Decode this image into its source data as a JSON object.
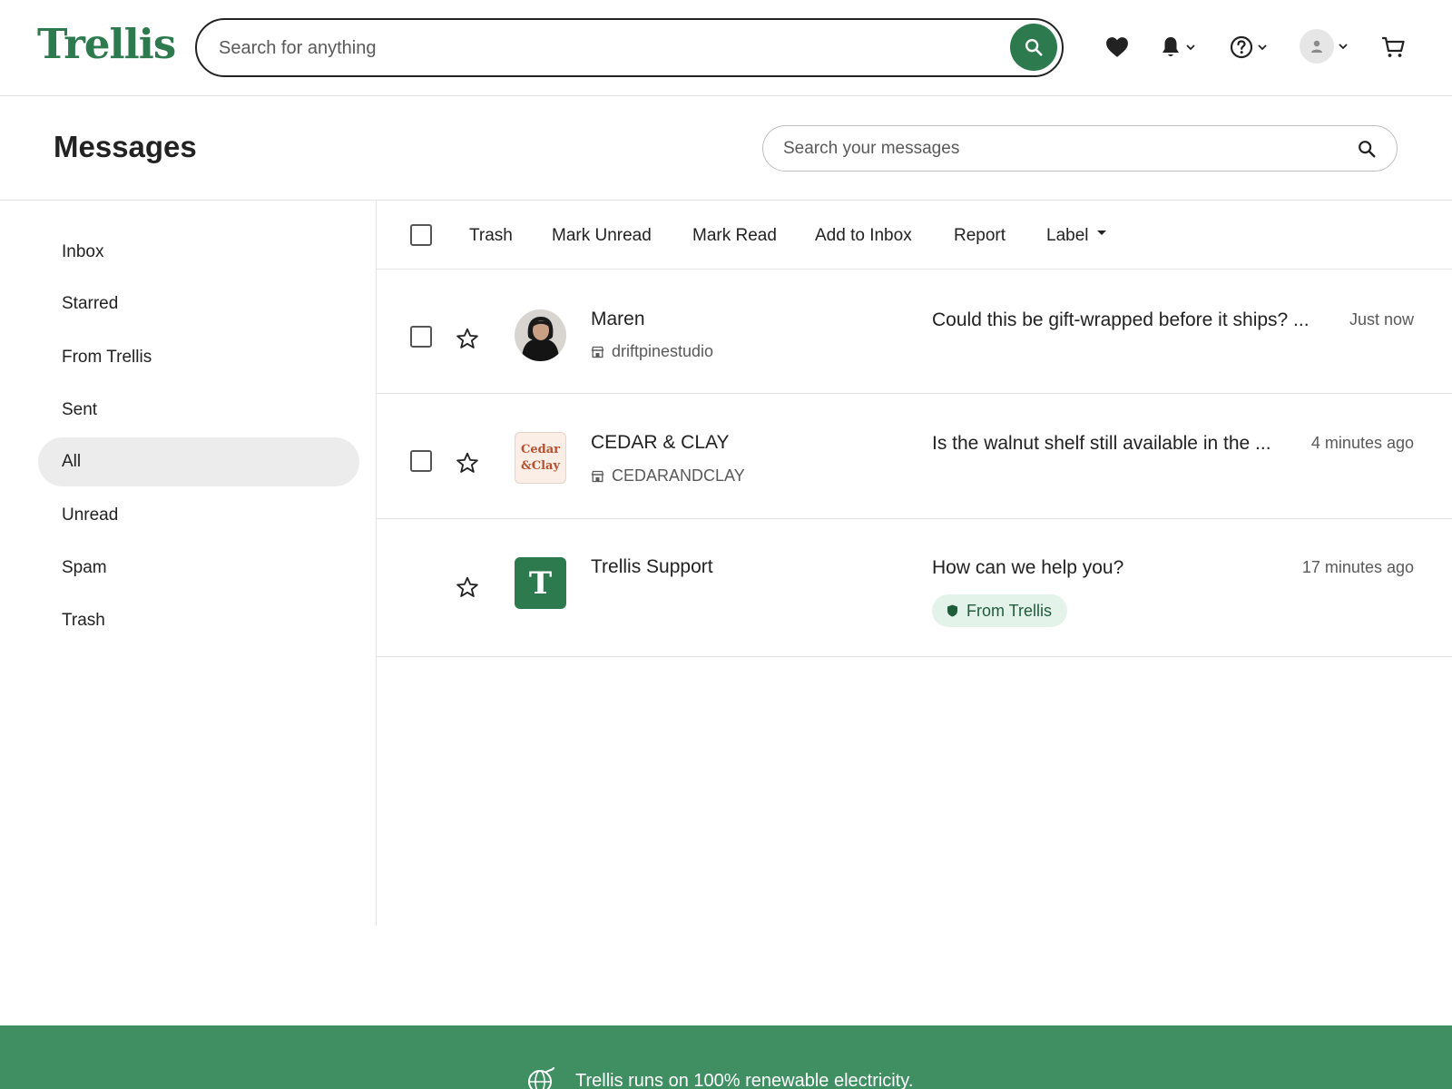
{
  "header": {
    "logo": "Trellis",
    "search_placeholder": "Search for anything",
    "icons": [
      "search-icon",
      "heart-icon",
      "bell-icon",
      "help-icon",
      "account-icon",
      "cart-icon"
    ]
  },
  "page": {
    "title": "Messages",
    "search_placeholder": "Search your messages"
  },
  "sidebar": {
    "items": [
      {
        "label": "Inbox",
        "active": false
      },
      {
        "label": "Starred",
        "active": false
      },
      {
        "label": "From Trellis",
        "active": false
      },
      {
        "label": "Sent",
        "active": false
      },
      {
        "label": "All",
        "active": true
      },
      {
        "label": "Unread",
        "active": false
      },
      {
        "label": "Spam",
        "active": false
      },
      {
        "label": "Trash",
        "active": false
      }
    ]
  },
  "toolbar": {
    "trash": "Trash",
    "mark_unread": "Mark Unread",
    "mark_read": "Mark Read",
    "add_to_inbox": "Add to Inbox",
    "report": "Report",
    "label": "Label"
  },
  "messages": [
    {
      "sender": "Maren",
      "shop": "driftpinestudio",
      "snippet": "Could this be gift-wrapped before it ships? ...",
      "time": "Just now"
    },
    {
      "sender": "CEDAR & CLAY",
      "shop": "CEDARANDCLAY",
      "avatar_text_1": "Cedar",
      "avatar_text_2": "&Clay",
      "snippet": "Is the walnut shelf still available in the ...",
      "time": "4 minutes ago"
    },
    {
      "sender": "Trellis Support",
      "avatar_letter": "T",
      "snippet": "How can we help you?",
      "badge": "From Trellis",
      "time": "17 minutes ago"
    }
  ],
  "footer": {
    "text": "Trellis runs on 100% renewable electricity."
  },
  "colors": {
    "brand_green": "#2d7a4f",
    "footer_green": "#3f8f63",
    "badge_bg": "#e4f3ea",
    "active_item_bg": "#ececec"
  }
}
